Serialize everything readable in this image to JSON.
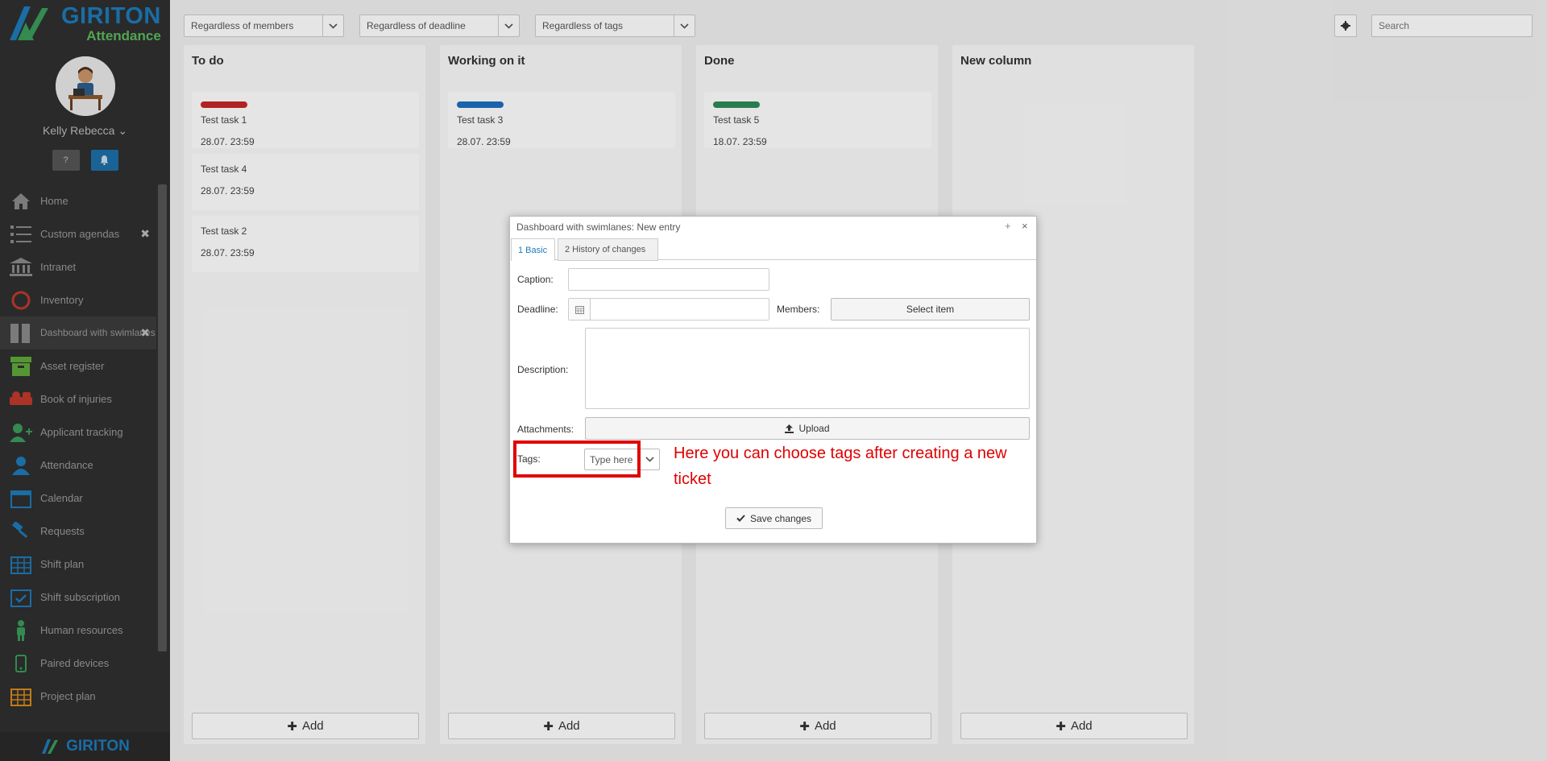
{
  "brand": {
    "line1": "GIRITON",
    "line2": "Attendance",
    "footer": "GIRITON"
  },
  "user": {
    "name": "Kelly Rebecca",
    "help_icon": "question-icon",
    "bell_icon": "bell-icon"
  },
  "sidebar": {
    "items": [
      {
        "label": "Home",
        "icon": "home-icon",
        "color": "#8a8a8a"
      },
      {
        "label": "Custom agendas",
        "icon": "list-icon",
        "color": "#8a8a8a",
        "closable": true
      },
      {
        "label": "Intranet",
        "icon": "bank-icon",
        "color": "#8a8a8a"
      },
      {
        "label": "Inventory",
        "icon": "ring-icon",
        "color": "#c0392b"
      },
      {
        "label": "Dashboard with swimlanes",
        "icon": "columns-icon",
        "color": "#8a8a8a",
        "closable": true,
        "active": true
      },
      {
        "label": "Asset register",
        "icon": "box-icon",
        "color": "#5fa83a"
      },
      {
        "label": "Book of injuries",
        "icon": "injury-icon",
        "color": "#c0392b"
      },
      {
        "label": "Applicant tracking",
        "icon": "add-user-icon",
        "color": "#3a9a5a"
      },
      {
        "label": "Attendance",
        "icon": "user-icon",
        "color": "#1e7ab8"
      },
      {
        "label": "Calendar",
        "icon": "calendar-icon",
        "color": "#1e7ab8"
      },
      {
        "label": "Requests",
        "icon": "gavel-icon",
        "color": "#1e7ab8"
      },
      {
        "label": "Shift plan",
        "icon": "grid-calendar-icon",
        "color": "#1e7ab8"
      },
      {
        "label": "Shift subscription",
        "icon": "calendar-check-icon",
        "color": "#1e7ab8"
      },
      {
        "label": "Human resources",
        "icon": "person-icon",
        "color": "#3a9a5a"
      },
      {
        "label": "Paired devices",
        "icon": "phone-icon",
        "color": "#3a9a5a"
      },
      {
        "label": "Project plan",
        "icon": "grid-calendar-icon",
        "color": "#d98a1a"
      }
    ]
  },
  "filters": {
    "members": "Regardless of members",
    "deadline": "Regardless of deadline",
    "tags": "Regardless of tags",
    "search_placeholder": "Search"
  },
  "board": {
    "add_label": "Add",
    "columns": [
      {
        "title": "To do",
        "cards": [
          {
            "title": "Test task 1",
            "date": "28.07. 23:59",
            "bar": "#c62828"
          },
          {
            "title": "Test task 4",
            "date": "28.07. 23:59",
            "bar": null
          },
          {
            "title": "Test task 2",
            "date": "28.07. 23:59",
            "bar": null
          }
        ]
      },
      {
        "title": "Working on it",
        "cards": [
          {
            "title": "Test task 3",
            "date": "28.07. 23:59",
            "bar": "#1e6fc0"
          }
        ]
      },
      {
        "title": "Done",
        "cards": [
          {
            "title": "Test task 5",
            "date": "18.07. 23:59",
            "bar": "#2e8b57"
          }
        ]
      },
      {
        "title": "New column",
        "cards": []
      }
    ]
  },
  "modal": {
    "title": "Dashboard with swimlanes: New entry",
    "max_glyph": "+",
    "close_glyph": "×",
    "tabs": [
      "1 Basic",
      "2 History of changes"
    ],
    "caption_label": "Caption:",
    "caption_value": "",
    "deadline_label": "Deadline:",
    "deadline_value": "",
    "members_label": "Members:",
    "select_item_label": "Select item",
    "description_label": "Description:",
    "attachments_label": "Attachments:",
    "upload_label": "Upload",
    "tags_label": "Tags:",
    "tags_placeholder": "Type here",
    "save_label": "Save changes"
  },
  "annotation": {
    "text": "Here you can choose tags after creating a new ticket",
    "color": "#e00000"
  }
}
